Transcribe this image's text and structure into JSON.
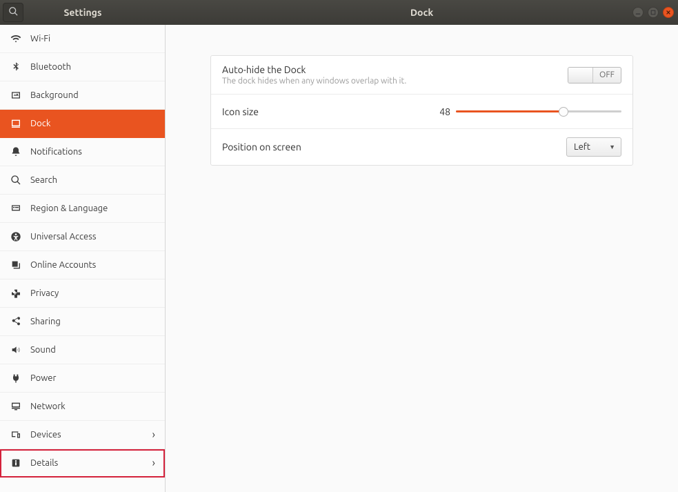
{
  "header": {
    "sidebar_title": "Settings",
    "window_title": "Dock"
  },
  "sidebar": {
    "items": [
      {
        "label": "Wi-Fi",
        "icon": "wifi",
        "active": false,
        "chevron": false
      },
      {
        "label": "Bluetooth",
        "icon": "bluetooth",
        "active": false,
        "chevron": false
      },
      {
        "label": "Background",
        "icon": "background",
        "active": false,
        "chevron": false
      },
      {
        "label": "Dock",
        "icon": "dock",
        "active": true,
        "chevron": false
      },
      {
        "label": "Notifications",
        "icon": "bell",
        "active": false,
        "chevron": false
      },
      {
        "label": "Search",
        "icon": "search",
        "active": false,
        "chevron": false
      },
      {
        "label": "Region & Language",
        "icon": "region",
        "active": false,
        "chevron": false
      },
      {
        "label": "Universal Access",
        "icon": "accessibility",
        "active": false,
        "chevron": false
      },
      {
        "label": "Online Accounts",
        "icon": "online-accounts",
        "active": false,
        "chevron": false
      },
      {
        "label": "Privacy",
        "icon": "privacy",
        "active": false,
        "chevron": false
      },
      {
        "label": "Sharing",
        "icon": "sharing",
        "active": false,
        "chevron": false
      },
      {
        "label": "Sound",
        "icon": "sound",
        "active": false,
        "chevron": false
      },
      {
        "label": "Power",
        "icon": "power",
        "active": false,
        "chevron": false
      },
      {
        "label": "Network",
        "icon": "network",
        "active": false,
        "chevron": false
      },
      {
        "label": "Devices",
        "icon": "devices",
        "active": false,
        "chevron": true
      },
      {
        "label": "Details",
        "icon": "details",
        "active": false,
        "chevron": true,
        "highlight": true
      }
    ]
  },
  "dock": {
    "autohide": {
      "title": "Auto-hide the Dock",
      "subtitle": "The dock hides when any windows overlap with it.",
      "state": "OFF"
    },
    "iconsize": {
      "label": "Icon size",
      "value": "48",
      "percent": 65
    },
    "position": {
      "label": "Position on screen",
      "value": "Left"
    }
  }
}
